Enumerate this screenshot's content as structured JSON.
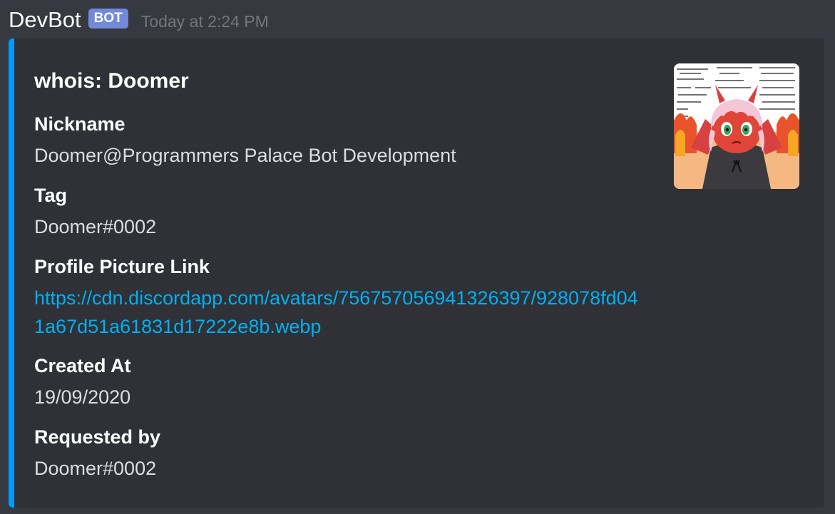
{
  "message": {
    "username": "DevBot",
    "bot_tag": "BOT",
    "timestamp": "Today at 2:24 PM"
  },
  "embed": {
    "accent_color": "#0099ff",
    "title": "whois: Doomer",
    "thumbnail_icon": "profile-avatar-image",
    "fields": [
      {
        "name": "Nickname",
        "value": "Doomer@Programmers Palace Bot Development"
      },
      {
        "name": "Tag",
        "value": "Doomer#0002"
      },
      {
        "name": "Profile Picture Link",
        "value": "https://cdn.discordapp.com/avatars/756757056941326397/928078fd041a67d51a61831d17222e8b.webp"
      },
      {
        "name": "Created At",
        "value": "19/09/2020"
      },
      {
        "name": "Requested by",
        "value": "Doomer#0002"
      }
    ]
  },
  "colors": {
    "background": "#36393f",
    "embed_background": "#2f3136",
    "bot_tag": "#7289da",
    "link": "#00b0f4"
  }
}
